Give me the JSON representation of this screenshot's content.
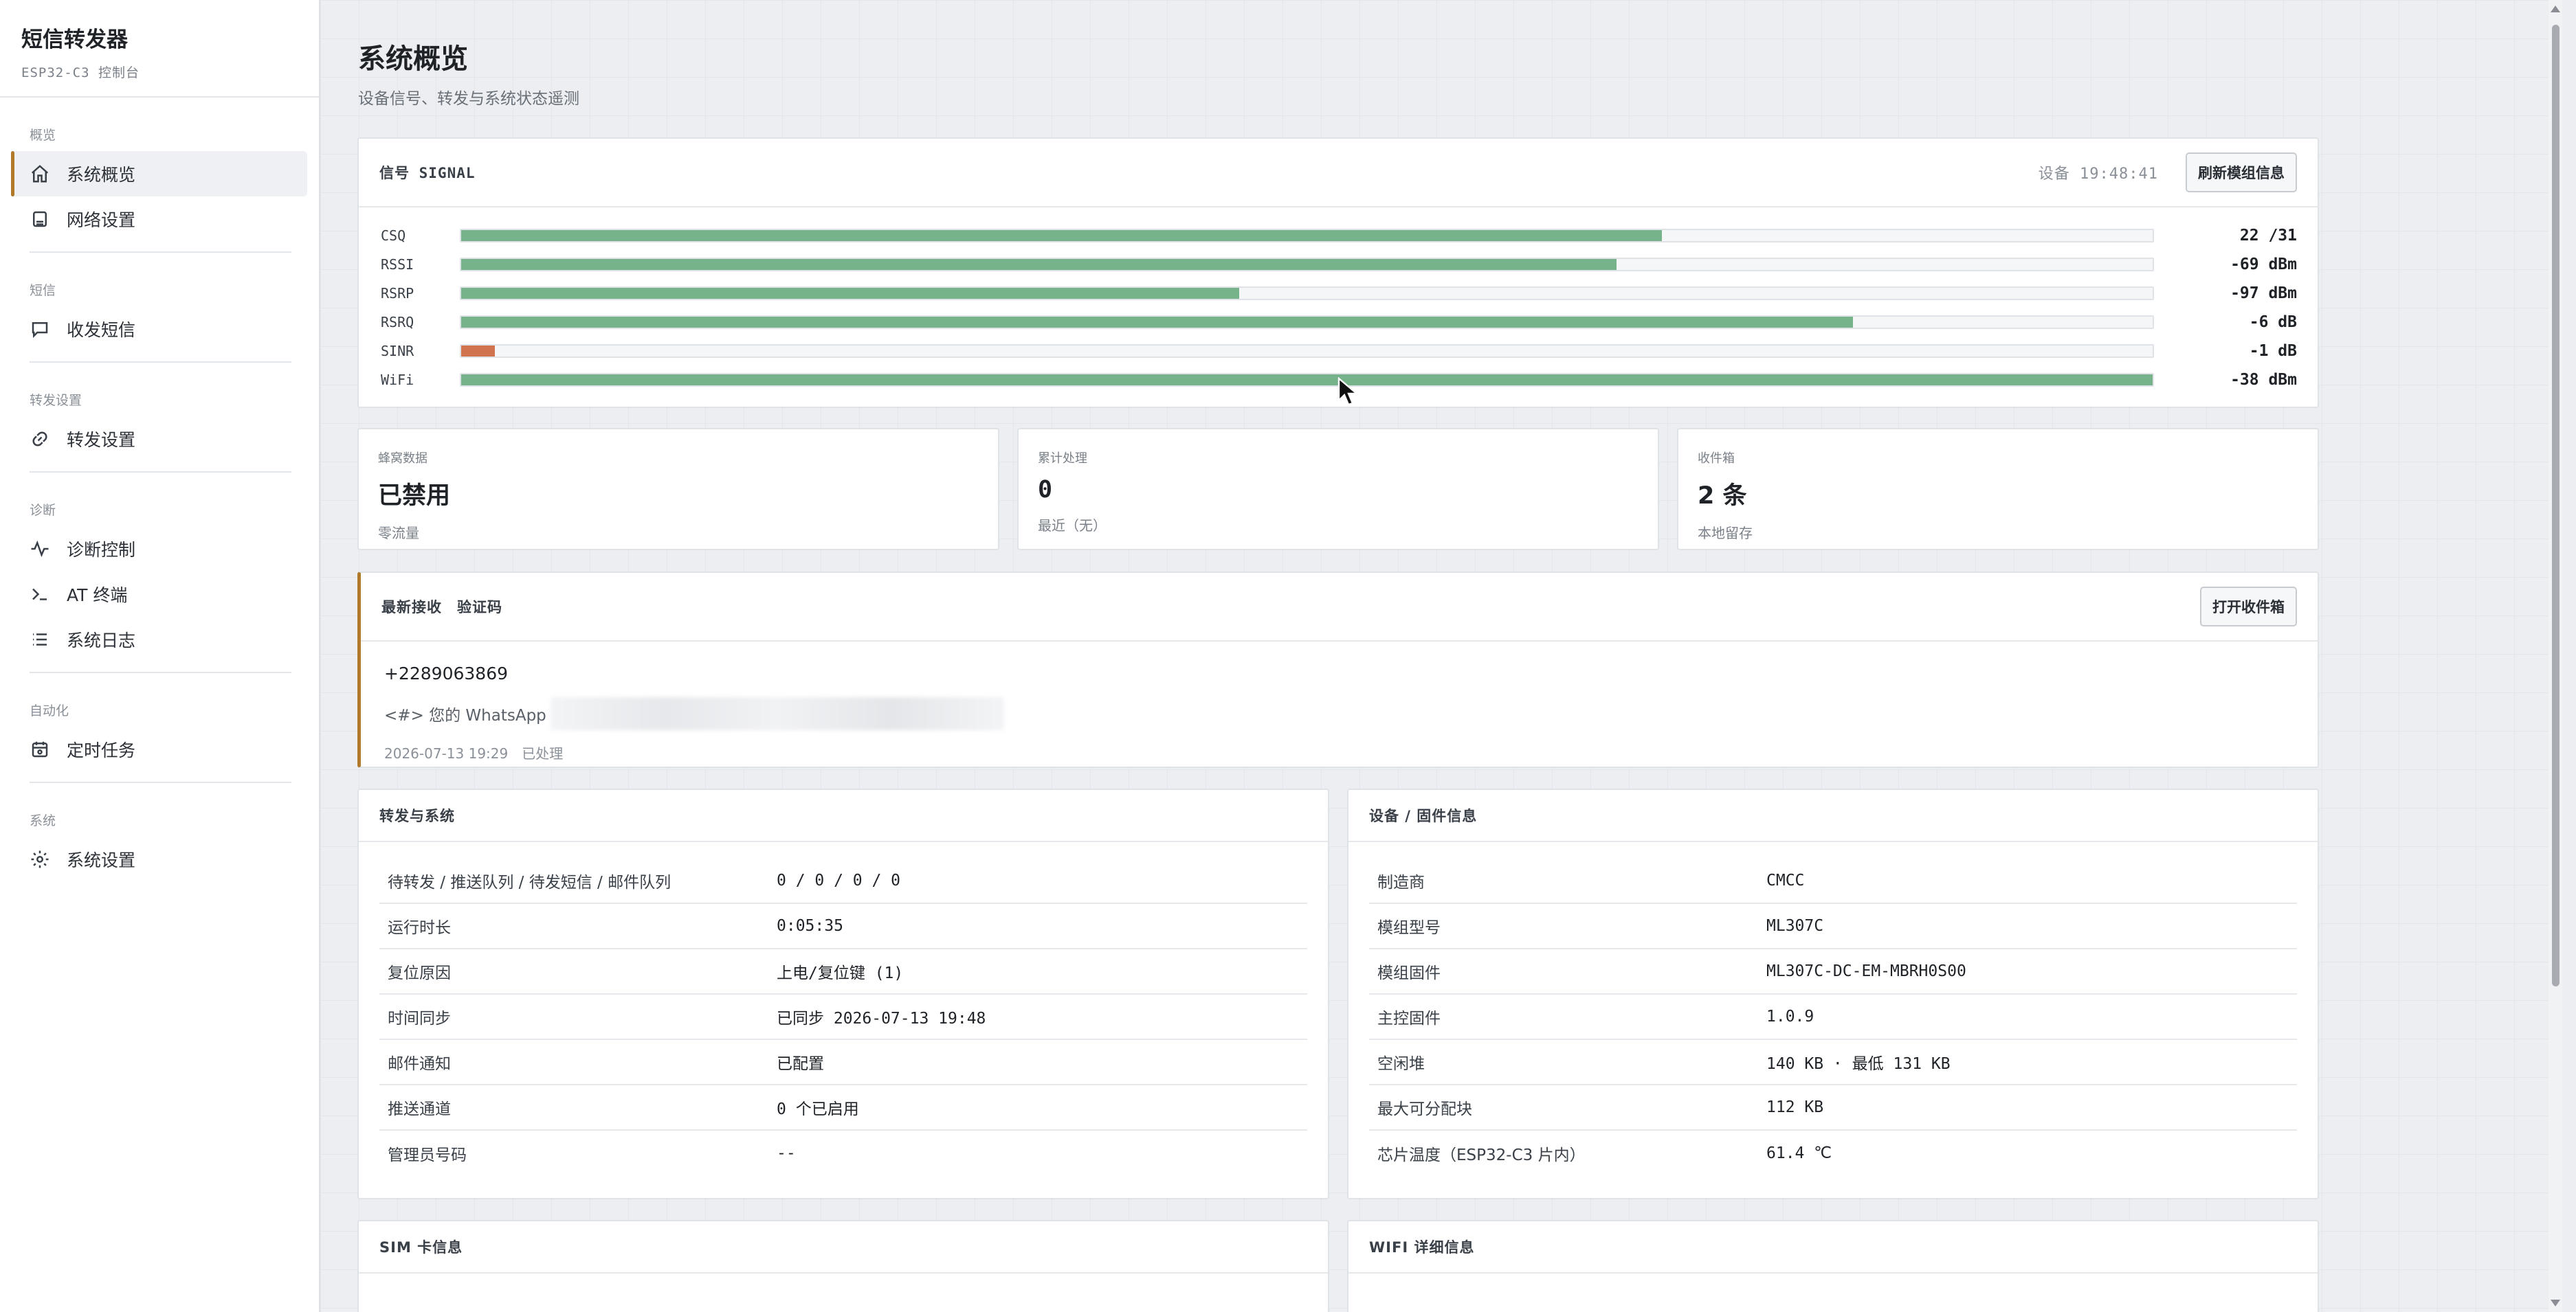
{
  "brand": {
    "title": "短信转发器",
    "subtitle": "ESP32-C3 控制台"
  },
  "nav": {
    "groups": [
      {
        "label": "概览",
        "items": [
          {
            "label": "系统概览",
            "icon": "home-icon",
            "active": true
          },
          {
            "label": "网络设置",
            "icon": "router-icon"
          }
        ]
      },
      {
        "label": "短信",
        "items": [
          {
            "label": "收发短信",
            "icon": "message-icon"
          }
        ]
      },
      {
        "label": "转发设置",
        "items": [
          {
            "label": "转发设置",
            "icon": "link-icon"
          }
        ]
      },
      {
        "label": "诊断",
        "items": [
          {
            "label": "诊断控制",
            "icon": "pulse-icon"
          },
          {
            "label": "AT 终端",
            "icon": "terminal-icon"
          },
          {
            "label": "系统日志",
            "icon": "list-icon"
          }
        ]
      },
      {
        "label": "自动化",
        "items": [
          {
            "label": "定时任务",
            "icon": "calendar-icon"
          }
        ]
      },
      {
        "label": "系统",
        "items": [
          {
            "label": "系统设置",
            "icon": "gear-icon"
          }
        ]
      }
    ]
  },
  "page": {
    "title": "系统概览",
    "subtitle": "设备信号、转发与系统状态遥测"
  },
  "signal": {
    "header": "信号 SIGNAL",
    "device_time": "设备 19:48:41",
    "refresh_button": "刷新模组信息",
    "rows": [
      {
        "label": "CSQ",
        "value": "22 /31",
        "level": 0.71,
        "status": "good"
      },
      {
        "label": "RSSI",
        "value": "-69 dBm",
        "level": 0.683,
        "status": "good"
      },
      {
        "label": "RSRP",
        "value": "-97 dBm",
        "level": 0.46,
        "status": "good"
      },
      {
        "label": "RSRQ",
        "value": "-6 dB",
        "level": 0.823,
        "status": "good"
      },
      {
        "label": "SINR",
        "value": "-1 dB",
        "level": 0.02,
        "status": "bad"
      },
      {
        "label": "WiFi",
        "value": "-38 dBm",
        "level": 1.0,
        "status": "good"
      }
    ]
  },
  "stats": [
    {
      "label": "蜂窝数据",
      "value": "已禁用",
      "note": "零流量"
    },
    {
      "label": "累计处理",
      "value": "0",
      "note": "最近（无）"
    },
    {
      "label": "收件箱",
      "value": "2 条",
      "note": "本地留存"
    }
  ],
  "latest": {
    "header": "最新接收　验证码",
    "open_button": "打开收件箱",
    "from": "+2289063869",
    "message_prefix": "<#> 您的 WhatsApp",
    "meta": "2026-07-13 19:29　已处理"
  },
  "forward_system": {
    "header": "转发与系统",
    "rows": [
      {
        "key": "待转发 / 推送队列 / 待发短信 / 邮件队列",
        "value": "0 / 0 / 0 / 0"
      },
      {
        "key": "运行时长",
        "value": "0:05:35"
      },
      {
        "key": "复位原因",
        "value": "上电/复位键 (1)"
      },
      {
        "key": "时间同步",
        "value": "已同步 2026-07-13 19:48"
      },
      {
        "key": "邮件通知",
        "value": "已配置"
      },
      {
        "key": "推送通道",
        "value": "0 个已启用"
      },
      {
        "key": "管理员号码",
        "value": "--"
      }
    ]
  },
  "device_info": {
    "header": "设备 / 固件信息",
    "rows": [
      {
        "key": "制造商",
        "value": "CMCC"
      },
      {
        "key": "模组型号",
        "value": "ML307C"
      },
      {
        "key": "模组固件",
        "value": "ML307C-DC-EM-MBRH0S00"
      },
      {
        "key": "主控固件",
        "value": "1.0.9"
      },
      {
        "key": "空闲堆",
        "value": "140 KB · 最低 131 KB"
      },
      {
        "key": "最大可分配块",
        "value": "112 KB"
      },
      {
        "key": "芯片温度（ESP32-C3 片内）",
        "value": "61.4 ℃"
      }
    ]
  },
  "sim_card": {
    "header": "SIM 卡信息"
  },
  "wifi_detail": {
    "header": "WIFI 详细信息"
  },
  "colors": {
    "accent": "#b07a2a",
    "good": "#76b38a",
    "bad": "#d0734f"
  }
}
